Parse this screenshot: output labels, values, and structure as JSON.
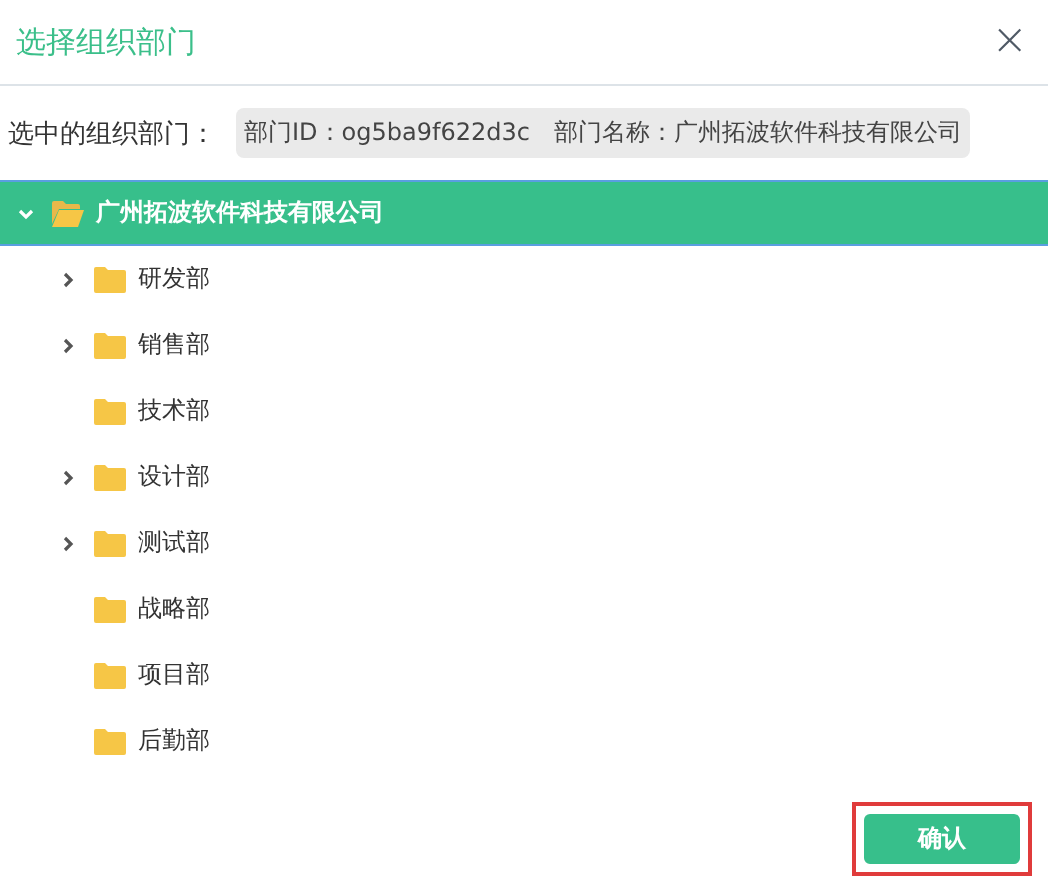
{
  "dialog": {
    "title": "选择组织部门",
    "close": "×"
  },
  "selection": {
    "label": "选中的组织部门：",
    "value": "部门ID：og5ba9f622d3c　部门名称：广州拓波软件科技有限公司"
  },
  "tree": [
    {
      "label": "广州拓波软件科技有限公司",
      "expanded": true,
      "selected": true,
      "children": [
        {
          "label": "研发部",
          "has_children": true,
          "expanded": false,
          "selected": false
        },
        {
          "label": "销售部",
          "has_children": true,
          "expanded": false,
          "selected": false
        },
        {
          "label": "技术部",
          "has_children": false,
          "expanded": false,
          "selected": false
        },
        {
          "label": "设计部",
          "has_children": true,
          "expanded": false,
          "selected": false
        },
        {
          "label": "测试部",
          "has_children": true,
          "expanded": false,
          "selected": false
        },
        {
          "label": "战略部",
          "has_children": false,
          "expanded": false,
          "selected": false
        },
        {
          "label": "项目部",
          "has_children": false,
          "expanded": false,
          "selected": false
        },
        {
          "label": "后勤部",
          "has_children": false,
          "expanded": false,
          "selected": false
        }
      ]
    }
  ],
  "buttons": [
    {
      "label": "确认",
      "focused": true
    }
  ]
}
